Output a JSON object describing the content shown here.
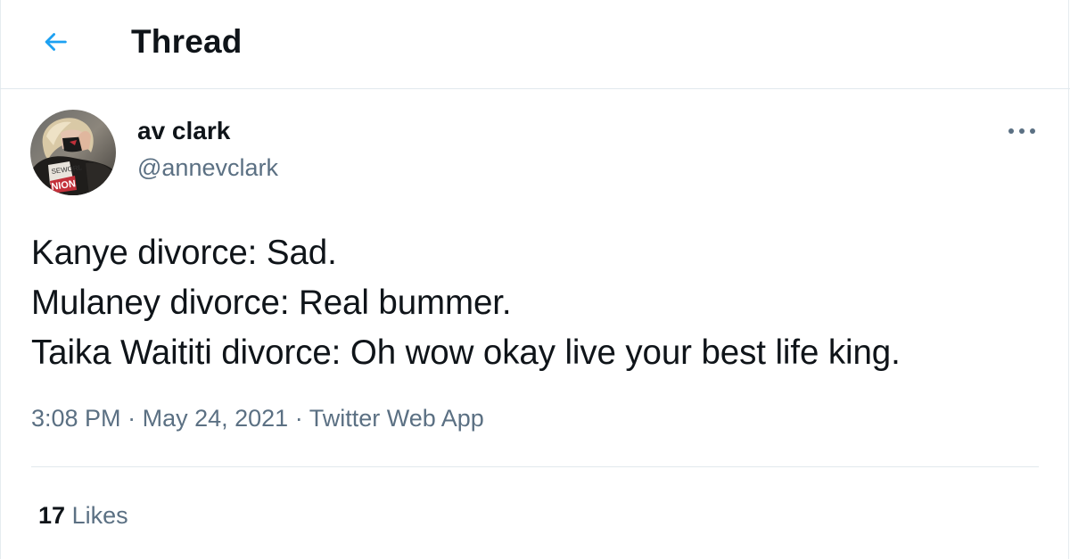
{
  "header": {
    "title": "Thread",
    "back_icon": "arrow-left-icon",
    "accent_color": "#1da1f2"
  },
  "tweet": {
    "author": {
      "display_name": "av clark",
      "handle": "@annevclark"
    },
    "more_icon": "more-horizontal-icon",
    "text_lines": [
      "Kanye divorce: Sad.",
      "Mulaney divorce: Real bummer.",
      "Taika Waititi divorce: Oh wow okay live your best life king."
    ],
    "time": "3:08 PM",
    "separator": "·",
    "date": "May 24, 2021",
    "source": "Twitter Web App",
    "likes_count": "17",
    "likes_label": "Likes"
  },
  "colors": {
    "text_primary": "#0f1419",
    "text_secondary": "#5b7083",
    "divider": "#e1e8ed"
  }
}
